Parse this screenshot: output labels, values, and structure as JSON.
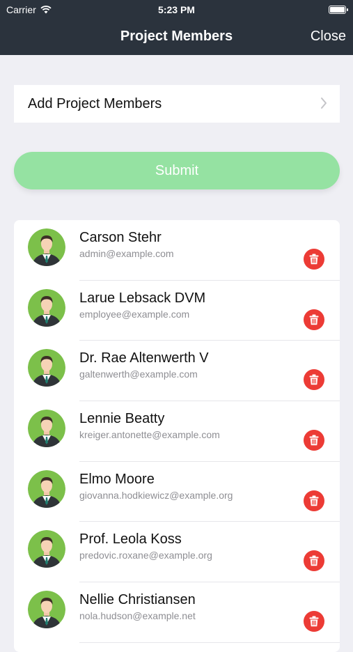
{
  "status_bar": {
    "carrier": "Carrier",
    "time": "5:23 PM"
  },
  "nav": {
    "title": "Project Members",
    "close_label": "Close"
  },
  "add_members": {
    "label": "Add Project Members"
  },
  "submit": {
    "label": "Submit"
  },
  "members": [
    {
      "name": "Carson Stehr",
      "email": "admin@example.com"
    },
    {
      "name": "Larue Lebsack DVM",
      "email": "employee@example.com"
    },
    {
      "name": "Dr. Rae Altenwerth V",
      "email": "galtenwerth@example.com"
    },
    {
      "name": "Lennie Beatty",
      "email": "kreiger.antonette@example.com"
    },
    {
      "name": "Elmo Moore",
      "email": "giovanna.hodkiewicz@example.org"
    },
    {
      "name": "Prof. Leola Koss",
      "email": "predovic.roxane@example.org"
    },
    {
      "name": "Nellie Christiansen",
      "email": "nola.hudson@example.net"
    }
  ],
  "colors": {
    "nav_background": "#2b333d",
    "submit_background": "#95e2a2",
    "delete_button": "#ec3b35",
    "avatar_background": "#7cc04a"
  },
  "icons": {
    "wifi": "wifi-icon",
    "battery": "battery-icon",
    "chevron": "chevron-right-icon",
    "avatar": "person-avatar-icon",
    "delete": "trash-icon"
  }
}
